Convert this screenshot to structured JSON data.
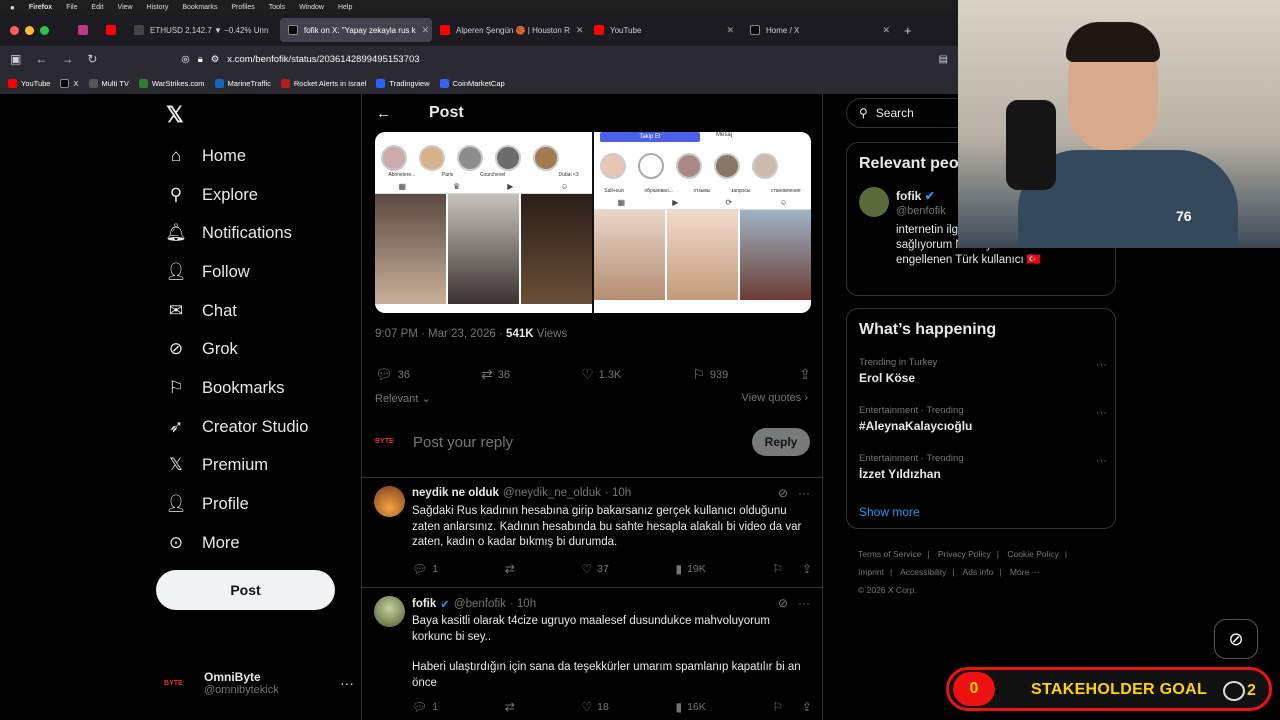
{
  "menubar": {
    "app": "Firefox",
    "items": [
      "File",
      "Edit",
      "View",
      "History",
      "Bookmarks",
      "Profiles",
      "Tools",
      "Window",
      "Help"
    ]
  },
  "tabs": [
    {
      "label": "",
      "color": "#c13584"
    },
    {
      "label": "",
      "color": "#ff0000"
    },
    {
      "label": "ETHUSD 2,142.7 ▼ −0.42% Unn",
      "color": "#131722"
    },
    {
      "label": "fofik on X: \"Yapay zekayla rus k",
      "color": "#000000"
    },
    {
      "label": "Alperen Şengün 🏀 | Houston R",
      "color": "#ff0000"
    },
    {
      "label": "YouTube",
      "color": "#ff0000"
    },
    {
      "label": "Home / X",
      "color": "#000000"
    }
  ],
  "address": {
    "host": "x.com",
    "path": "/benfofik/status/2036142899495153703"
  },
  "bookmarks": [
    {
      "label": "YouTube",
      "color": "#ff0000"
    },
    {
      "label": "X",
      "color": "#000000"
    },
    {
      "label": "Multi TV",
      "color": "#444444"
    },
    {
      "label": "WarStrikes.com",
      "color": "#2e7d32"
    },
    {
      "label": "MarineTraffic",
      "color": "#1565c0"
    },
    {
      "label": "Rocket Alerts in Israel",
      "color": "#b71c1c"
    },
    {
      "label": "Tradingview",
      "color": "#2962ff"
    },
    {
      "label": "CoinMarketCap",
      "color": "#3861fb"
    }
  ],
  "nav": {
    "items": [
      {
        "label": "Home",
        "icon": "home-icon"
      },
      {
        "label": "Explore",
        "icon": "search-icon"
      },
      {
        "label": "Notifications",
        "icon": "bell-icon"
      },
      {
        "label": "Follow",
        "icon": "follow-icon"
      },
      {
        "label": "Chat",
        "icon": "mail-icon"
      },
      {
        "label": "Grok",
        "icon": "grok-icon"
      },
      {
        "label": "Bookmarks",
        "icon": "bookmark-icon"
      },
      {
        "label": "Creator Studio",
        "icon": "rocket-icon"
      },
      {
        "label": "Premium",
        "icon": "x-icon"
      },
      {
        "label": "Profile",
        "icon": "person-icon"
      },
      {
        "label": "More",
        "icon": "more-icon"
      }
    ],
    "post_button": "Post",
    "account": {
      "name": "OmniByte",
      "handle": "@omnibytekick",
      "avatar_text": "BYTE"
    }
  },
  "post": {
    "header": "Post",
    "media": {
      "left_highlights": [
        "Abonelere...",
        "Paris",
        "Courchevel",
        "",
        "Dubai <3"
      ],
      "right_follow": "Takip Et",
      "right_message": "Mesaj",
      "right_highlights": [
        "Salt+sun",
        "образован...",
        "отзывы",
        "запросы",
        "становление"
      ]
    },
    "time": "9:07 PM · Mar 23, 2026 ·",
    "views_count": "541K",
    "views_label": "Views",
    "stats": {
      "replies": "36",
      "reposts": "36",
      "likes": "1.3K",
      "bookmarks": "939"
    },
    "relevant": "Relevant",
    "view_quotes": "View quotes",
    "reply_placeholder": "Post your reply",
    "reply_button": "Reply",
    "reply_avatar": "BYTE"
  },
  "replies": [
    {
      "name": "neydik ne olduk",
      "handle": "@neydik_ne_olduk",
      "time": "· 10h",
      "verified": false,
      "text": "Sağdaki Rus kadının hesabına girip bakarsanız gerçek kullanıcı olduğunu zaten anlarsınız. Kadının hesabında bu sahte hesapla alakalı bi video da var zaten, kadın o kadar bıkmış bi durumda.",
      "replies": "1",
      "reposts": "",
      "likes": "37",
      "views": "19K"
    },
    {
      "name": "fofik",
      "handle": "@benfofik",
      "time": "· 10h",
      "verified": true,
      "text": "Baya kasitli olarak t4cize ugruyo maalesef dusundukce mahvoluyorum korkunc bi sey..",
      "text2": "Haberi ulaştırdığın için sana da teşekkürler umarım spamlanıp kapatılır bi an önce",
      "replies": "1",
      "reposts": "",
      "likes": "18",
      "views": "16K"
    }
  ],
  "sidebar": {
    "search_placeholder": "Search",
    "relevant_title": "Relevant peo",
    "person": {
      "name": "fofik",
      "handle": "@benfofik",
      "bio": "internetin ilg gündeme eriştirmenizi sağlıyorum Netenyahu Tarafından engellenen Türk kullanıcı 🇹🇷"
    },
    "happening_title": "What’s happening",
    "trends": [
      {
        "category": "Trending in Turkey",
        "title": "Erol Köse"
      },
      {
        "category": "Entertainment · Trending",
        "title": "#AleynaKalaycıoğlu"
      },
      {
        "category": "Entertainment · Trending",
        "title": "İzzet Yıldızhan"
      }
    ],
    "show_more": "Show more",
    "footer": [
      "Terms of Service",
      "|",
      "Privacy Policy",
      "|",
      "Cookie Policy",
      "|",
      "Imprint",
      "|",
      "Accessibility",
      "|",
      "Ads info",
      "|",
      "More ···",
      "© 2026 X Corp."
    ]
  },
  "overlay": {
    "goal_count": "0",
    "goal_label": "STAKEHOLDER GOAL",
    "goal_target": "2",
    "cam_logo": "76"
  }
}
